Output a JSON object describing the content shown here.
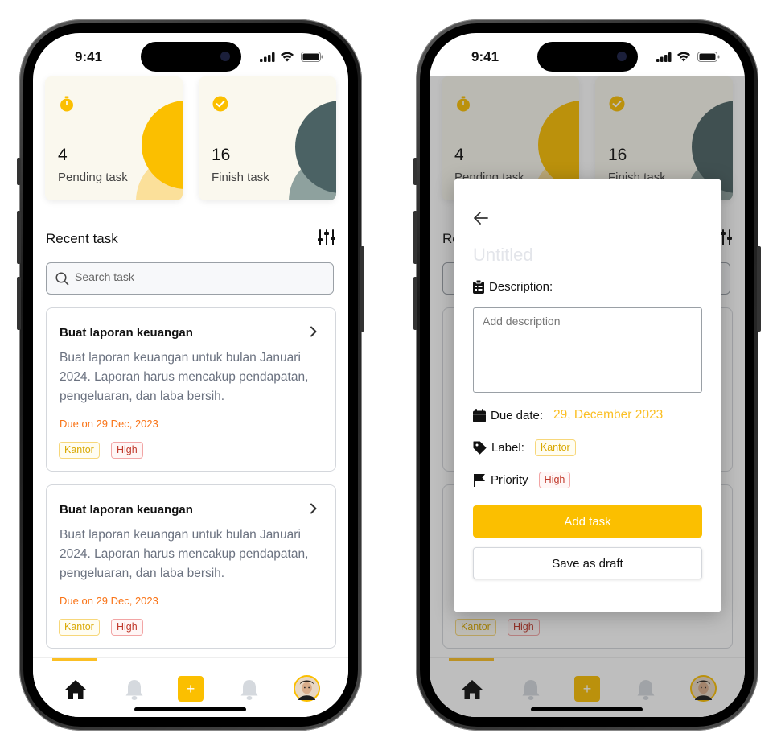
{
  "status": {
    "time": "9:41"
  },
  "stats": [
    {
      "value": "4",
      "label": "Pending task"
    },
    {
      "value": "16",
      "label": "Finish task"
    }
  ],
  "recent": {
    "title": "Recent task",
    "search_placeholder": "Search task"
  },
  "tasks": [
    {
      "title": "Buat laporan keuangan",
      "description": "Buat laporan keuangan untuk bulan Januari 2024. Laporan harus mencakup pendapatan, pengeluaran, dan laba bersih.",
      "due": "Due on 29 Dec, 2023",
      "label": "Kantor",
      "priority": "High"
    },
    {
      "title": "Buat laporan keuangan",
      "description": "Buat laporan keuangan untuk bulan Januari 2024. Laporan harus mencakup pendapatan, pengeluaran, dan laba bersih.",
      "due": "Due on 29 Dec, 2023",
      "label": "Kantor",
      "priority": "High"
    }
  ],
  "nav": {
    "add_symbol": "+",
    "items": [
      "home-icon",
      "bell-icon",
      "add-icon",
      "bell-icon",
      "avatar"
    ],
    "active_index": 0
  },
  "modal": {
    "title_placeholder": "Untitled",
    "description_label": "Description:",
    "description_placeholder": "Add description",
    "due_label": "Due date:",
    "due_value": "29, December 2023",
    "label_label": "Label:",
    "label_value": "Kantor",
    "priority_label": "Priority",
    "priority_value": "High",
    "add_button": "Add task",
    "draft_button": "Save as draft"
  },
  "colors": {
    "accent": "#fbbf00",
    "pending_circle": "#fbbf00",
    "finish_circle": "#4b6264",
    "due_text": "#f97316",
    "due_value": "#fbbf24",
    "kantor_text": "#d9a800",
    "high_text": "#c0392b"
  }
}
